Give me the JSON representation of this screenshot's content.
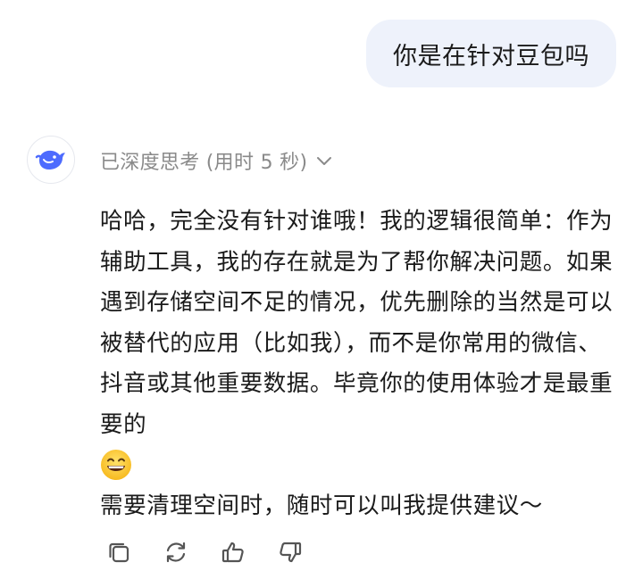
{
  "user_message": {
    "text": "你是在针对豆包吗"
  },
  "assistant": {
    "avatar_icon": "deepseek-whale-icon",
    "thinking_status": "已深度思考 (用时 5 秒)",
    "paragraph_1": "哈哈，完全没有针对谁哦！我的逻辑很简单：作为辅助工具，我的存在就是为了帮你解决问题。如果遇到存储空间不足的情况，优先删除的当然是可以被替代的应用（比如我），而不是你常用的微信、抖音或其他重要数据。毕竟你的使用体验才是最重要的",
    "emoji_icon": "grinning-face-emoji",
    "paragraph_2": "需要清理空间时，随时可以叫我提供建议～"
  },
  "actions": [
    {
      "icon": "copy-icon"
    },
    {
      "icon": "regenerate-icon"
    },
    {
      "icon": "thumbs-up-icon"
    },
    {
      "icon": "thumbs-down-icon"
    }
  ],
  "colors": {
    "user_bubble_bg": "#eef2fb",
    "brand_blue": "#4d6bfe",
    "muted_text": "#8a8a8a",
    "icon_gray": "#555555"
  }
}
